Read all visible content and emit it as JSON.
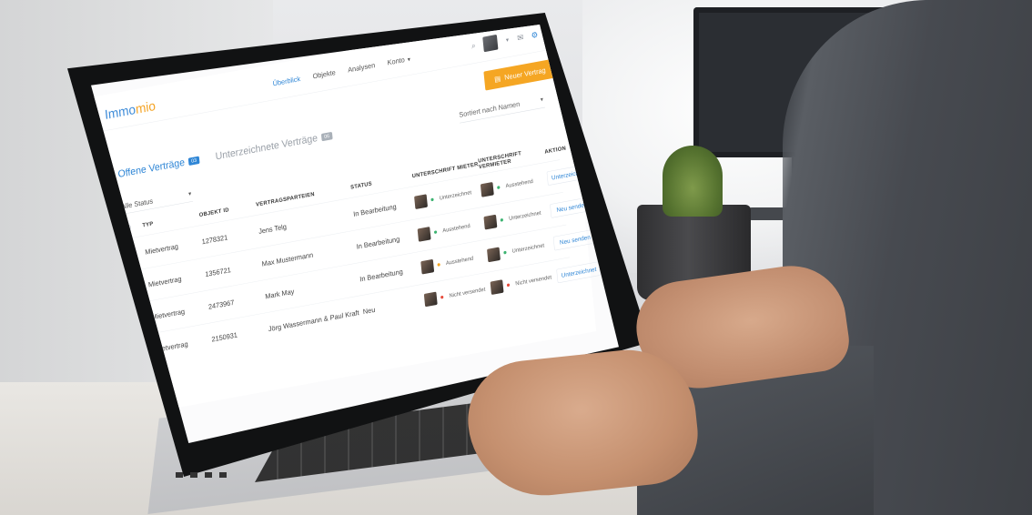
{
  "app": {
    "logo_prefix": "Immo",
    "logo_suffix": "mio"
  },
  "nav": {
    "items": [
      {
        "label": "Überblick",
        "active": true
      },
      {
        "label": "Objekte",
        "active": false
      },
      {
        "label": "Analysen",
        "active": false
      },
      {
        "label": "Konto",
        "active": false
      }
    ]
  },
  "toolbar": {
    "new_contract_label": "Neuer Vertrag"
  },
  "tabs": [
    {
      "label": "Offene Verträge",
      "badge": "03",
      "active": true
    },
    {
      "label": "Unterzeichnete Verträge",
      "badge": "06",
      "active": false
    }
  ],
  "sort": {
    "label": "Sortiert nach Namen"
  },
  "filter": {
    "label": "Alle Status"
  },
  "table": {
    "headers": {
      "type": "TYP",
      "object_id": "OBJEKT ID",
      "parties": "VERTRAGSPARTEIEN",
      "status": "STATUS",
      "tenant_sig": "UNTERSCHRIFT MIETER",
      "landlord_sig": "UNTERSCHRIFT VERMIETER",
      "action": "AKTION"
    },
    "rows": [
      {
        "type": "Mietvertrag",
        "object_id": "1278321",
        "parties": "Jens Telg",
        "status": "In Bearbeitung",
        "tenant_sig": "Unterzeichnet",
        "tenant_color": "#3cb371",
        "landlord_sig": "Ausstehend",
        "landlord_color": "#3cb371",
        "action": "Unterzeichnet"
      },
      {
        "type": "Mietvertrag",
        "object_id": "1356721",
        "parties": "Max Mustermann",
        "status": "In Bearbeitung",
        "tenant_sig": "Ausstehend",
        "tenant_color": "#3cb371",
        "landlord_sig": "Unterzeichnet",
        "landlord_color": "#3cb371",
        "action": "Neu senden"
      },
      {
        "type": "Mietvertrag",
        "object_id": "2473967",
        "parties": "Mark May",
        "status": "In Bearbeitung",
        "tenant_sig": "Ausstehend",
        "tenant_color": "#f5a623",
        "landlord_sig": "Unterzeichnet",
        "landlord_color": "#3cb371",
        "action": "Neu senden"
      },
      {
        "type": "Mietvertrag",
        "object_id": "2150931",
        "parties": "Jörg Wassermann & Paul Kraft",
        "status": "Neu",
        "tenant_sig": "Nicht versendet",
        "tenant_color": "#e74c3c",
        "landlord_sig": "Nicht versendet",
        "landlord_color": "#e74c3c",
        "action": "Unterzeichnet"
      }
    ]
  },
  "colors": {
    "accent": "#2f86d6",
    "brand_orange": "#f5a623"
  },
  "icons": {
    "search": "search-icon",
    "mail": "mail-icon",
    "settings": "gear-icon",
    "new": "document-plus-icon"
  }
}
